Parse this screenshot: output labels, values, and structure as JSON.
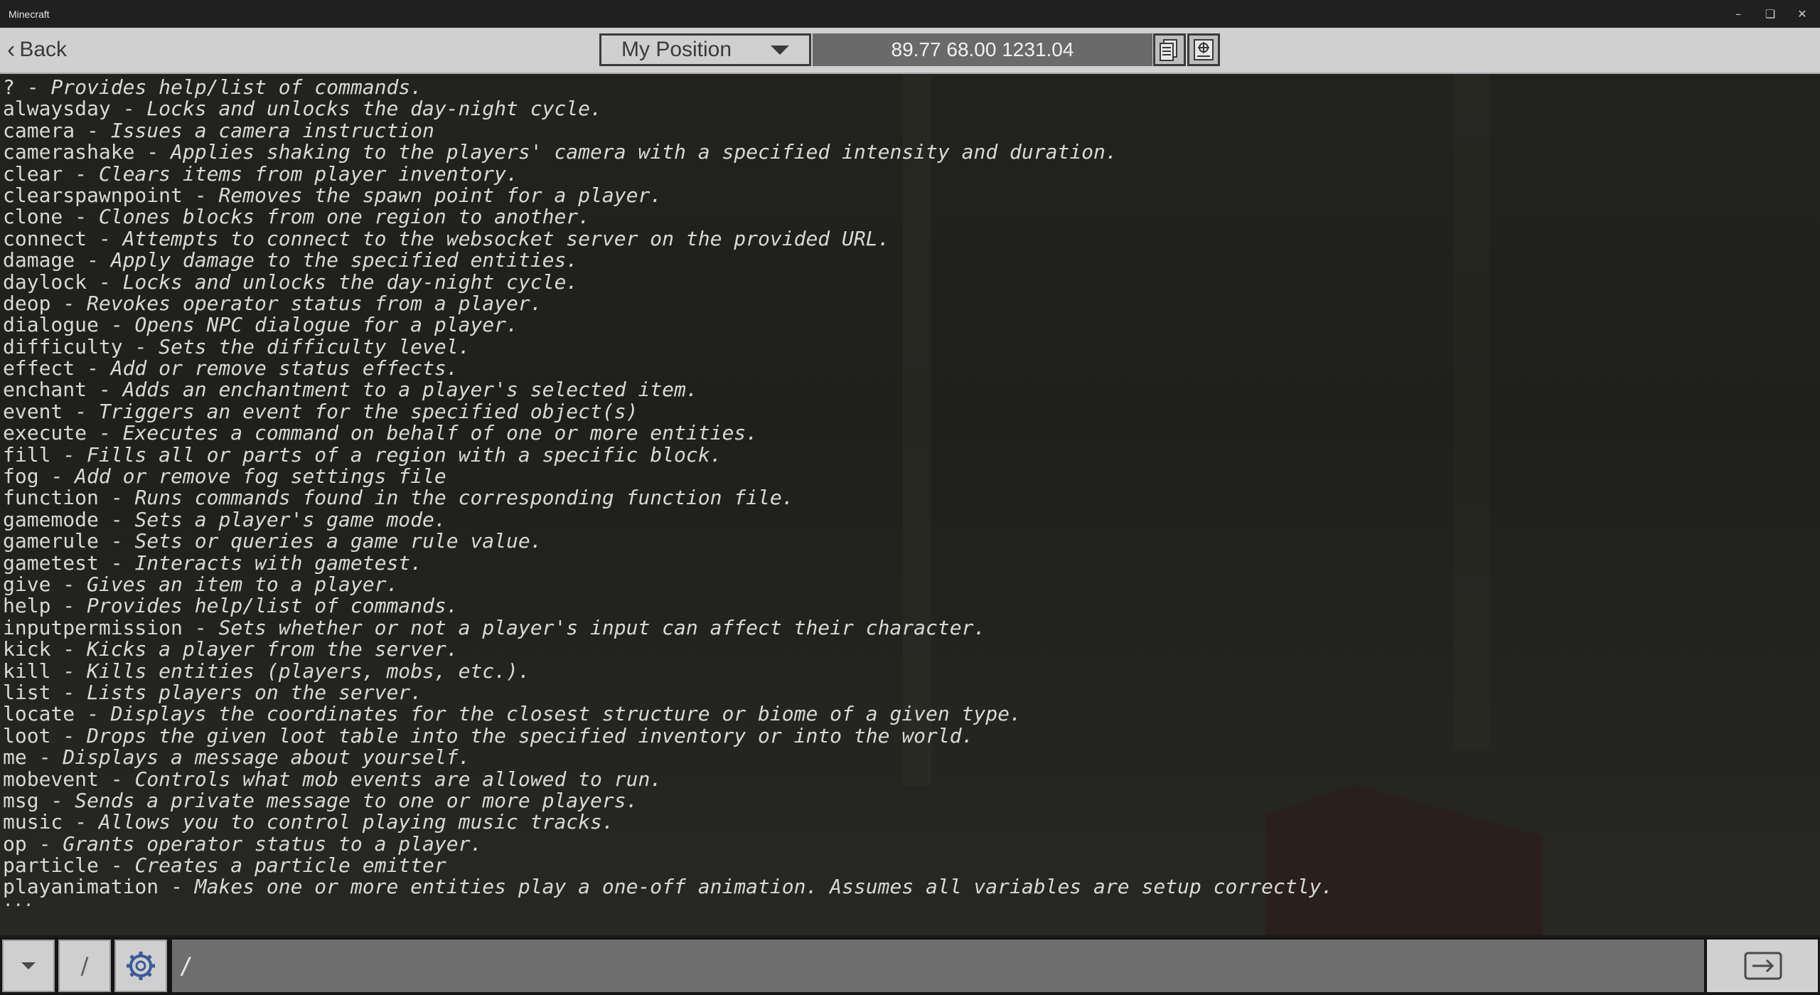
{
  "window": {
    "title": "Minecraft"
  },
  "topbar": {
    "back_label": "Back",
    "position_select": "My Position",
    "coordinates": "89.77 68.00 1231.04"
  },
  "output": {
    "lines": [
      {
        "cmd": "? - ",
        "desc": "Provides help/list of commands."
      },
      {
        "cmd": "alwaysday - ",
        "desc": "Locks and unlocks the day-night cycle."
      },
      {
        "cmd": "camera - ",
        "desc": "Issues a camera instruction"
      },
      {
        "cmd": "camerashake - ",
        "desc": "Applies shaking to the players' camera with a specified intensity and duration."
      },
      {
        "cmd": "clear - ",
        "desc": "Clears items from player inventory."
      },
      {
        "cmd": "clearspawnpoint - ",
        "desc": "Removes the spawn point for a player."
      },
      {
        "cmd": "clone - ",
        "desc": "Clones blocks from one region to another."
      },
      {
        "cmd": "connect - ",
        "desc": "Attempts to connect to the websocket server on the provided URL."
      },
      {
        "cmd": "damage - ",
        "desc": "Apply damage to the specified entities."
      },
      {
        "cmd": "daylock - ",
        "desc": "Locks and unlocks the day-night cycle."
      },
      {
        "cmd": "deop - ",
        "desc": "Revokes operator status from a player."
      },
      {
        "cmd": "dialogue - ",
        "desc": "Opens NPC dialogue for a player."
      },
      {
        "cmd": "difficulty - ",
        "desc": "Sets the difficulty level."
      },
      {
        "cmd": "effect - ",
        "desc": "Add or remove status effects."
      },
      {
        "cmd": "enchant - ",
        "desc": "Adds an enchantment to a player's selected item."
      },
      {
        "cmd": "event - ",
        "desc": "Triggers an event for the specified object(s)"
      },
      {
        "cmd": "execute - ",
        "desc": "Executes a command on behalf of one or more entities."
      },
      {
        "cmd": "fill - ",
        "desc": "Fills all or parts of a region with a specific block."
      },
      {
        "cmd": "fog - ",
        "desc": "Add or remove fog settings file"
      },
      {
        "cmd": "function - ",
        "desc": "Runs commands found in the corresponding function file."
      },
      {
        "cmd": "gamemode - ",
        "desc": "Sets a player's game mode."
      },
      {
        "cmd": "gamerule - ",
        "desc": "Sets or queries a game rule value."
      },
      {
        "cmd": "gametest - ",
        "desc": "Interacts with gametest."
      },
      {
        "cmd": "give - ",
        "desc": "Gives an item to a player."
      },
      {
        "cmd": "help - ",
        "desc": "Provides help/list of commands."
      },
      {
        "cmd": "inputpermission - ",
        "desc": "Sets whether or not a player's input can affect their character."
      },
      {
        "cmd": "kick - ",
        "desc": "Kicks a player from the server."
      },
      {
        "cmd": "kill - ",
        "desc": "Kills entities (players, mobs, etc.)."
      },
      {
        "cmd": "list - ",
        "desc": "Lists players on the server."
      },
      {
        "cmd": "locate - ",
        "desc": "Displays the coordinates for the closest structure or biome of a given type."
      },
      {
        "cmd": "loot - ",
        "desc": "Drops the given loot table into the specified inventory or into the world."
      },
      {
        "cmd": "me - ",
        "desc": "Displays a message about yourself."
      },
      {
        "cmd": "mobevent - ",
        "desc": "Controls what mob events are allowed to run."
      },
      {
        "cmd": "msg - ",
        "desc": "Sends a private message to one or more players."
      },
      {
        "cmd": "music - ",
        "desc": "Allows you to control playing music tracks."
      },
      {
        "cmd": "op - ",
        "desc": "Grants operator status to a player."
      },
      {
        "cmd": "particle - ",
        "desc": "Creates a particle emitter"
      },
      {
        "cmd": "playanimation - ",
        "desc": "Makes one or more entities play a one-off animation. Assumes all variables are setup correctly."
      }
    ],
    "ellipsis": "..."
  },
  "bottombar": {
    "slash_label": "/",
    "chat_value": "/"
  },
  "icons": {
    "back": "chevron-left-icon",
    "dropdown": "triangle-down-icon",
    "copy": "copy-coordinates-icon",
    "coords_action": "coordinates-action-icon",
    "history": "chevron-down-icon",
    "settings": "gear-icon",
    "send": "arrow-right-icon"
  }
}
